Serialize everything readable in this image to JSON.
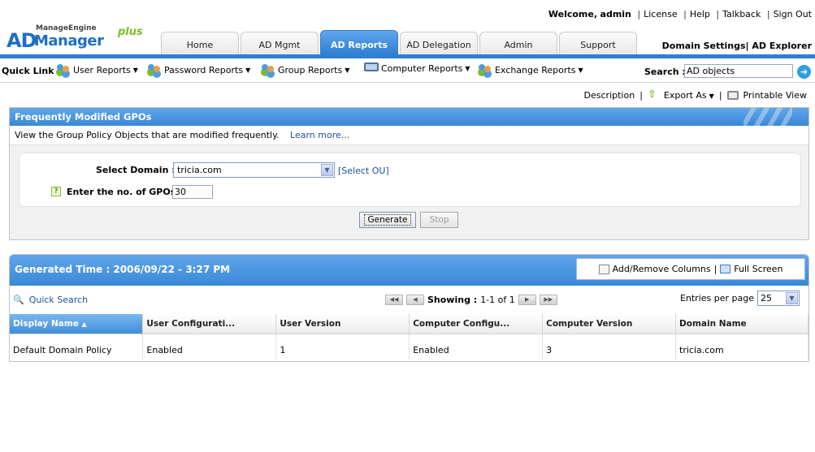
{
  "header": {
    "welcome_prefix": "Welcome,",
    "user": "admin",
    "links": [
      "License",
      "Help",
      "Talkback",
      "Sign Out"
    ],
    "logo": {
      "company": "ManageEngine",
      "product_ad": "AD",
      "product": "Manager",
      "plus": "plus"
    },
    "domain_links": "Domain Settings| AD Explorer",
    "colors": {
      "accent": "#2f7fd4",
      "brand_green": "#7cbd2a"
    }
  },
  "tabs": [
    {
      "label": "Home",
      "active": false
    },
    {
      "label": "AD Mgmt",
      "active": false
    },
    {
      "label": "AD Reports",
      "active": true
    },
    {
      "label": "AD Delegation",
      "active": false
    },
    {
      "label": "Admin",
      "active": false
    },
    {
      "label": "Support",
      "active": false
    }
  ],
  "quicklink": {
    "label": "Quick Link :",
    "menus": [
      {
        "label": "User Reports",
        "icon": "users-icon"
      },
      {
        "label": "Password Reports",
        "icon": "users-key-icon"
      },
      {
        "label": "Group Reports",
        "icon": "group-icon"
      },
      {
        "label": "Computer Reports",
        "icon": "computer-icon"
      },
      {
        "label": "Exchange Reports",
        "icon": "exchange-icon"
      }
    ],
    "search_label": "Search :",
    "search_value": "AD objects"
  },
  "toolbar": {
    "description": "Description",
    "export": "Export As",
    "printable": "Printable View"
  },
  "panel1": {
    "title": "Frequently Modified GPOs",
    "description": "View the Group Policy Objects that are modified frequently.",
    "learn_more": "Learn more...",
    "domain_label": "Select Domain :",
    "domain_value": "tricia.com",
    "select_ou": "[Select OU]",
    "gpo_label": "Enter the no. of GPOs :",
    "gpo_value": "30",
    "generate": "Generate",
    "stop": "Stop"
  },
  "panel2": {
    "generated_time": "Generated Time : 2006/09/22 - 3:27 PM",
    "add_remove": "Add/Remove Columns",
    "full_screen": "Full Screen",
    "quick_search": "Quick Search",
    "showing_label": "Showing :",
    "showing_value": "1-1 of 1",
    "entries_label": "Entries per page",
    "entries_value": "25",
    "columns": [
      "Display Name",
      "User Configurati...",
      "User Version",
      "Computer Configu...",
      "Computer Version",
      "Domain Name"
    ],
    "rows": [
      [
        "Default Domain Policy",
        "Enabled",
        "1",
        "Enabled",
        "3",
        "tricia.com"
      ]
    ]
  }
}
